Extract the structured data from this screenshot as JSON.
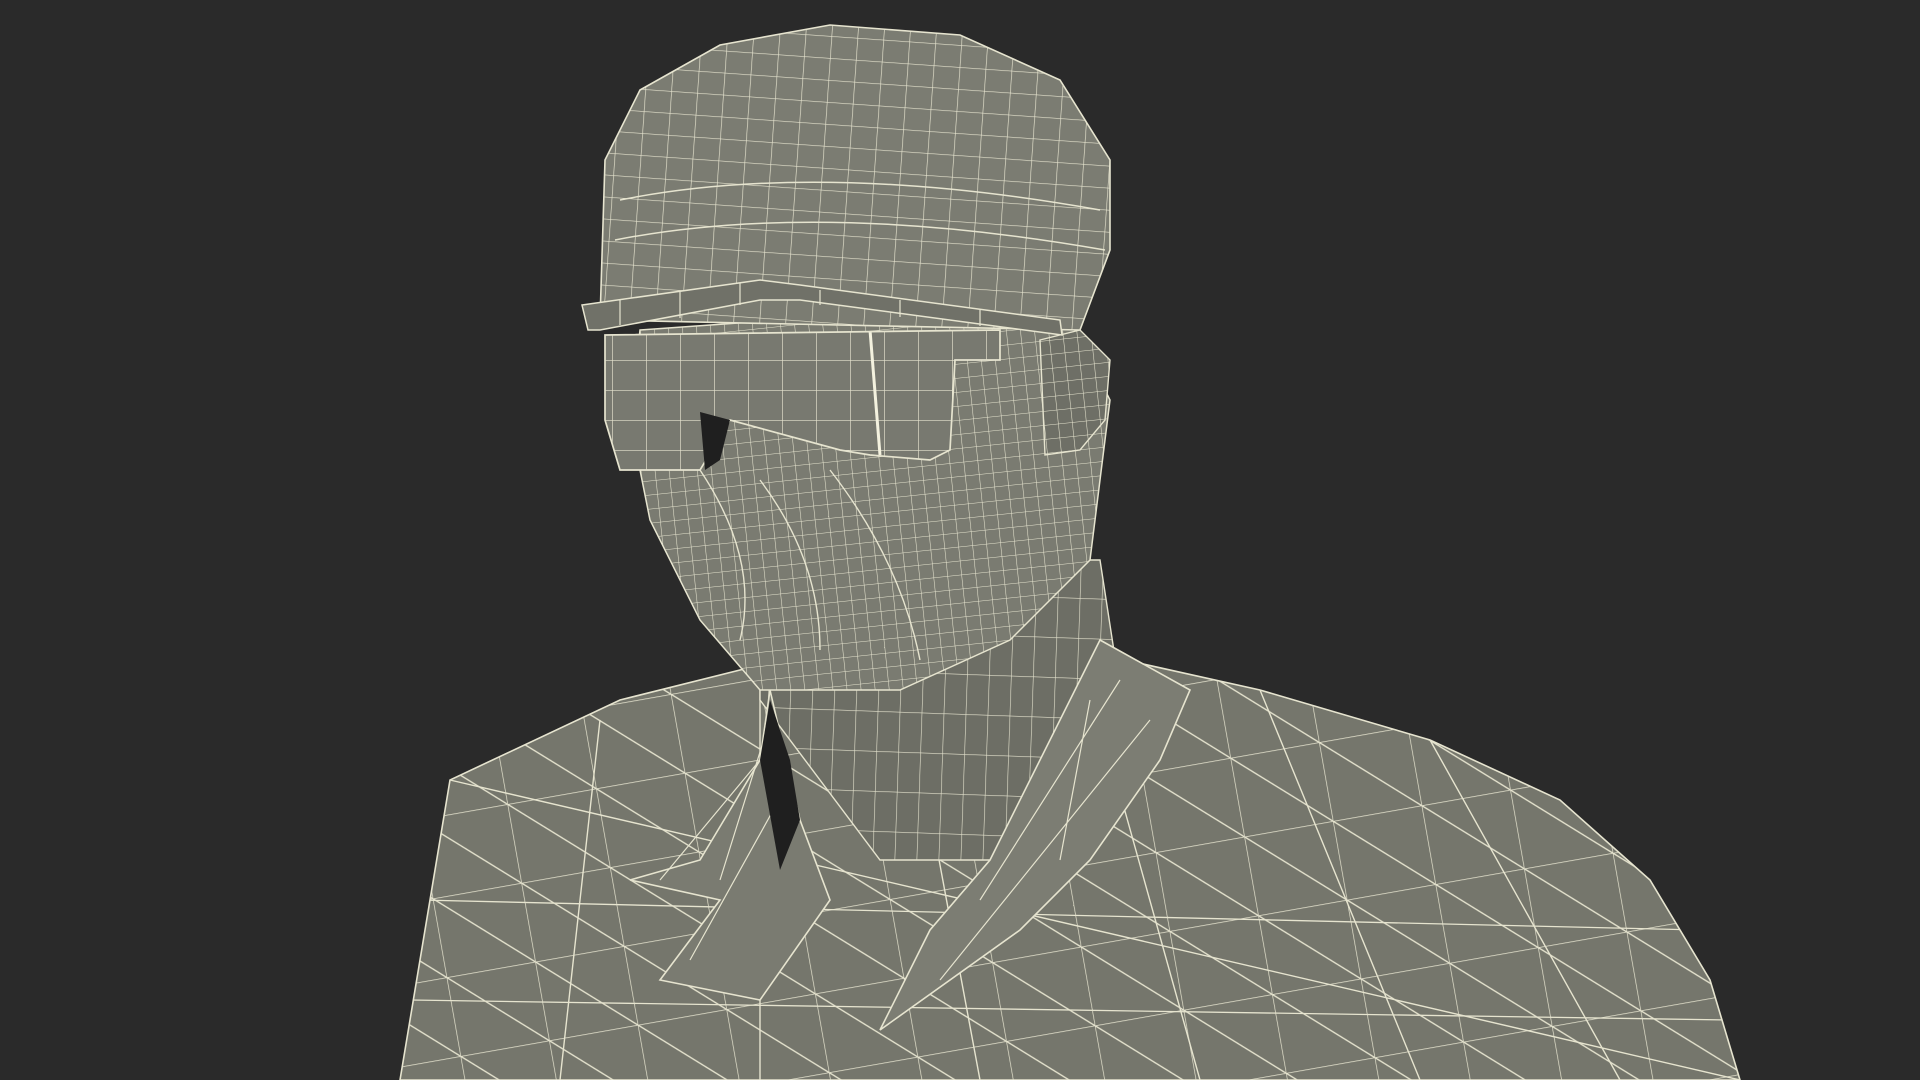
{
  "scene": {
    "subject": "wireframe-bust-worker-with-cap-and-safety-glasses"
  },
  "colors": {
    "background": "#2a2a2a",
    "mesh_fill": "#75766c",
    "mesh_fill_light": "#84857a",
    "mesh_fill_dark": "#5f6057",
    "shadow": "#1f1f1f",
    "wire": "#e6e4cf"
  }
}
